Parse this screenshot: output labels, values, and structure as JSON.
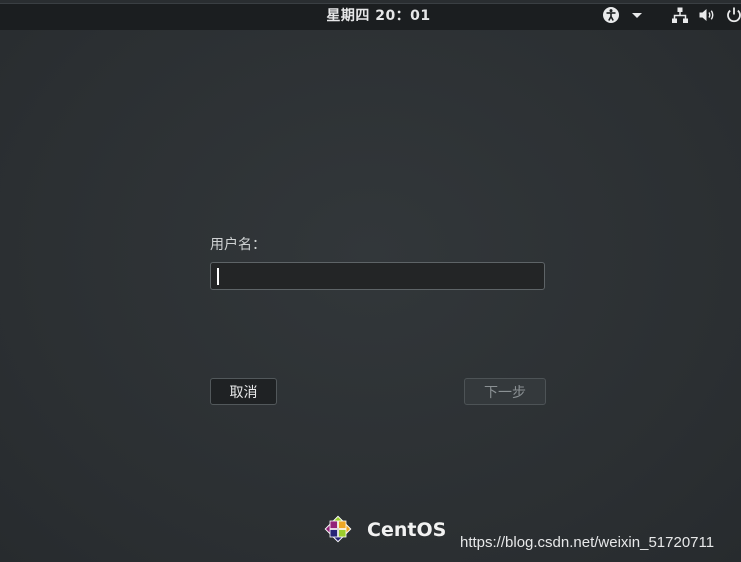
{
  "topbar": {
    "clock": "星期四  20：01",
    "icons": [
      "accessibility-icon",
      "chevron-down-icon",
      "network-icon",
      "volume-icon",
      "power-icon"
    ]
  },
  "login": {
    "username_label": "用户名：",
    "username_value": "",
    "cancel_label": "取消",
    "next_label": "下一步"
  },
  "branding": {
    "name": "CentOS"
  },
  "watermark": "https://blog.csdn.net/weixin_51720711",
  "colors": {
    "background": "#2d3134",
    "topbar": "#1b1e20",
    "input_border": "#5e6467"
  }
}
